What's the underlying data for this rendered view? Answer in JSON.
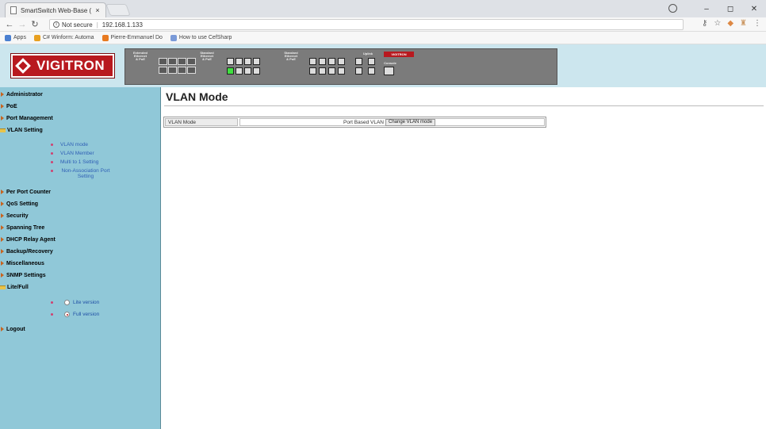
{
  "browser": {
    "tab_title": "SmartSwitch Web-Base (",
    "tab_close": "×",
    "address_status": "Not secure",
    "address_url": "192.168.1.133",
    "bookmarks": [
      {
        "label": "Apps",
        "color": "#4a7fd0"
      },
      {
        "label": "C# Winform: Automa",
        "color": "#e8a020"
      },
      {
        "label": "Pierre-Emmanuel Do",
        "color": "#e87a20"
      },
      {
        "label": "How to use CefSharp",
        "color": "#7a9ad8"
      }
    ]
  },
  "brand": {
    "logo_text": "VIGITRON",
    "logo_color": "#b8191f"
  },
  "switch_panel": {
    "group1": [
      "Extended",
      "Ethernet",
      "& PoE"
    ],
    "group2": [
      "Standard",
      "Ethernet",
      "& PoE"
    ],
    "group3": [
      "Standard",
      "Ethernet",
      "& PoE"
    ],
    "uplink_label": "Uplink",
    "console_label": "Console",
    "sw_logo": "VIGITRON"
  },
  "sidebar": {
    "items": [
      {
        "label": "Administrator"
      },
      {
        "label": "PoE"
      },
      {
        "label": "Port Management"
      },
      {
        "label": "VLAN Setting"
      },
      {
        "label": "Per Port Counter"
      },
      {
        "label": "QoS Setting"
      },
      {
        "label": "Security"
      },
      {
        "label": "Spanning Tree"
      },
      {
        "label": "DHCP Relay Agent"
      },
      {
        "label": "Backup/Recovery"
      },
      {
        "label": "Miscellaneous"
      },
      {
        "label": "SNMP Settings"
      },
      {
        "label": "Lite/Full"
      },
      {
        "label": "Logout"
      }
    ],
    "vlan_sub": [
      "VLAN mode",
      "VLAN Member",
      "Multi to 1 Setting",
      "Non-Association Port Setting"
    ],
    "lite_full": {
      "lite": "Lite version",
      "full": "Full version",
      "selected": "full"
    }
  },
  "main": {
    "title": "VLAN Mode",
    "row_label": "VLAN Mode",
    "row_value": "Port Based VLAN",
    "change_button": "Change VLAN mode"
  }
}
